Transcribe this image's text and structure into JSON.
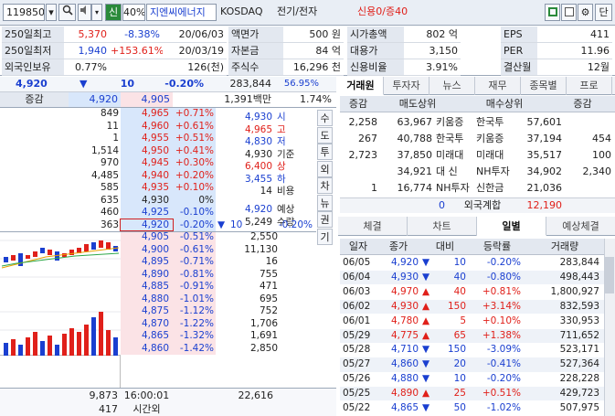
{
  "toolbar": {
    "code": "119850",
    "tag": "신",
    "pct": "40%",
    "name": "지엔씨에너지",
    "market": "KOSDAQ",
    "sector": "전기/전자",
    "credit": "신용0/증40",
    "right": "단"
  },
  "info": [
    {
      "l1": "250일최고",
      "v1": "5,370",
      "c1": "-8.38%",
      "d1": "20/06/03",
      "l2": "액면가",
      "v2": "500 원",
      "l3": "시가총액",
      "v3": "802 억",
      "l4": "EPS",
      "v4": "411"
    },
    {
      "l1": "250일최저",
      "v1": "1,940",
      "c1": "+153.61%",
      "d1": "20/03/19",
      "l2": "자본금",
      "v2": "84 억",
      "l3": "대용가",
      "v3": "3,150",
      "l4": "PER",
      "v4": "11.96"
    },
    {
      "l1": "외국인보유",
      "v1": "0.77%",
      "c1": "",
      "d1": "126(천)",
      "l2": "주식수",
      "v2": "16,296 천",
      "l3": "신용비율",
      "v3": "3.91%",
      "l4": "결산월",
      "v4": "12월"
    }
  ],
  "quote": {
    "price": "4,920",
    "arrow": "▼",
    "diff": "10",
    "rate": "-0.20%",
    "volume": "283,844",
    "volrate": "56.95%"
  },
  "quote2": {
    "label": "증감",
    "a": "4,920",
    "b": "4,905",
    "amt": "1,391백만",
    "pct": "1.74%"
  },
  "sell_orders": [
    {
      "qty": "849",
      "price": "4,965",
      "rate": "+0.71%"
    },
    {
      "qty": "11",
      "price": "4,960",
      "rate": "+0.61%"
    },
    {
      "qty": "1",
      "price": "4,955",
      "rate": "+0.51%"
    },
    {
      "qty": "1,514",
      "price": "4,950",
      "rate": "+0.41%"
    },
    {
      "qty": "970",
      "price": "4,945",
      "rate": "+0.30%"
    },
    {
      "qty": "4,485",
      "price": "4,940",
      "rate": "+0.20%"
    },
    {
      "qty": "585",
      "price": "4,935",
      "rate": "+0.10%"
    },
    {
      "qty": "635",
      "price": "4,930",
      "rate": "0%"
    },
    {
      "qty": "460",
      "price": "4,925",
      "rate": "-0.10%"
    },
    {
      "qty": "363",
      "price": "4,920",
      "rate": "-0.20%"
    }
  ],
  "buy_orders": [
    {
      "price": "4,905",
      "rate": "-0.51%",
      "qty": "2,550"
    },
    {
      "price": "4,900",
      "rate": "-0.61%",
      "qty": "11,130"
    },
    {
      "price": "4,895",
      "rate": "-0.71%",
      "qty": "16"
    },
    {
      "price": "4,890",
      "rate": "-0.81%",
      "qty": "755"
    },
    {
      "price": "4,885",
      "rate": "-0.91%",
      "qty": "471"
    },
    {
      "price": "4,880",
      "rate": "-1.01%",
      "qty": "695"
    },
    {
      "price": "4,875",
      "rate": "-1.12%",
      "qty": "752"
    },
    {
      "price": "4,870",
      "rate": "-1.22%",
      "qty": "1,706"
    },
    {
      "price": "4,865",
      "rate": "-1.32%",
      "qty": "1,691"
    },
    {
      "price": "4,860",
      "rate": "-1.42%",
      "qty": "2,850"
    }
  ],
  "stats": [
    {
      "v": "4,930",
      "l": "시",
      "cls": "blue0"
    },
    {
      "v": "4,965",
      "l": "고",
      "cls": "red"
    },
    {
      "v": "4,830",
      "l": "저",
      "cls": "blue"
    },
    {
      "v": "4,930",
      "l": "기준",
      "cls": ""
    },
    {
      "v": "6,400",
      "l": "상",
      "cls": "red"
    },
    {
      "v": "3,455",
      "l": "하",
      "cls": "blue"
    },
    {
      "v": "14",
      "l": "비용",
      "cls": ""
    }
  ],
  "expect": {
    "price": "4,920",
    "label": "예상",
    "qty": "5,249",
    "qlabel": "수량",
    "arrow": "▼",
    "diff": "10",
    "rate": "-0.20%"
  },
  "side_buttons": [
    "수",
    "도",
    "투",
    "외",
    "차",
    "뉴",
    "권",
    "기"
  ],
  "footer": {
    "sell_total": "9,873",
    "time": "16:00:01",
    "buy_total": "22,616",
    "after_qty": "417",
    "after_label": "시간외"
  },
  "broker_tabs": [
    "거래원",
    "투자자",
    "뉴스",
    "재무",
    "종목별",
    "프로"
  ],
  "broker_header": [
    "증감",
    "매도상위",
    "매수상위",
    "증감"
  ],
  "brokers": [
    {
      "dsell": "2,258",
      "sqty": "63,967",
      "sname": "키움증",
      "bname": "한국투",
      "bqty": "57,601",
      "dbuy": ""
    },
    {
      "dsell": "267",
      "sqty": "40,788",
      "sname": "한국투",
      "bname": "키움증",
      "bqty": "37,194",
      "dbuy": "454"
    },
    {
      "dsell": "2,723",
      "sqty": "37,850",
      "sname": "미래대",
      "bname": "미래대",
      "bqty": "35,517",
      "dbuy": "100"
    },
    {
      "dsell": "",
      "sqty": "34,921",
      "sname": "대 신",
      "bname": "NH투자",
      "bqty": "34,902",
      "dbuy": "2,340"
    },
    {
      "dsell": "1",
      "sqty": "16,774",
      "sname": "NH투자",
      "bname": "신한금",
      "bqty": "21,036",
      "dbuy": ""
    }
  ],
  "foreign": {
    "sell": "0",
    "label": "외국계합",
    "buy": "12,190"
  },
  "daily_tabs": [
    "체결",
    "차트",
    "일별",
    "예상체결"
  ],
  "daily_header": [
    "일자",
    "종가",
    "대비",
    "등락률",
    "거래량"
  ],
  "daily": [
    {
      "date": "06/05",
      "close": "4,920",
      "dir": "▼",
      "diff": "10",
      "rate": "-0.20%",
      "vol": "283,844",
      "c": "blue"
    },
    {
      "date": "06/04",
      "close": "4,930",
      "dir": "▼",
      "diff": "40",
      "rate": "-0.80%",
      "vol": "498,443",
      "c": "blue"
    },
    {
      "date": "06/03",
      "close": "4,970",
      "dir": "▲",
      "diff": "40",
      "rate": "+0.81%",
      "vol": "1,800,927",
      "c": "red"
    },
    {
      "date": "06/02",
      "close": "4,930",
      "dir": "▲",
      "diff": "150",
      "rate": "+3.14%",
      "vol": "832,593",
      "c": "red"
    },
    {
      "date": "06/01",
      "close": "4,780",
      "dir": "▲",
      "diff": "5",
      "rate": "+0.10%",
      "vol": "330,953",
      "c": "red"
    },
    {
      "date": "05/29",
      "close": "4,775",
      "dir": "▲",
      "diff": "65",
      "rate": "+1.38%",
      "vol": "711,652",
      "c": "red"
    },
    {
      "date": "05/28",
      "close": "4,710",
      "dir": "▼",
      "diff": "150",
      "rate": "-3.09%",
      "vol": "523,171",
      "c": "blue"
    },
    {
      "date": "05/27",
      "close": "4,860",
      "dir": "▼",
      "diff": "20",
      "rate": "-0.41%",
      "vol": "527,364",
      "c": "blue"
    },
    {
      "date": "05/26",
      "close": "4,880",
      "dir": "▼",
      "diff": "10",
      "rate": "-0.20%",
      "vol": "228,228",
      "c": "blue"
    },
    {
      "date": "05/25",
      "close": "4,890",
      "dir": "▲",
      "diff": "25",
      "rate": "+0.51%",
      "vol": "429,723",
      "c": "red"
    },
    {
      "date": "05/22",
      "close": "4,865",
      "dir": "▼",
      "diff": "50",
      "rate": "-1.02%",
      "vol": "507,975",
      "c": "blue"
    }
  ],
  "colors": {
    "red": "#e0201a",
    "blue": "#1a3fd0",
    "sell_bg": "#d8e7fb",
    "buy_bg": "#fbe3e6"
  }
}
